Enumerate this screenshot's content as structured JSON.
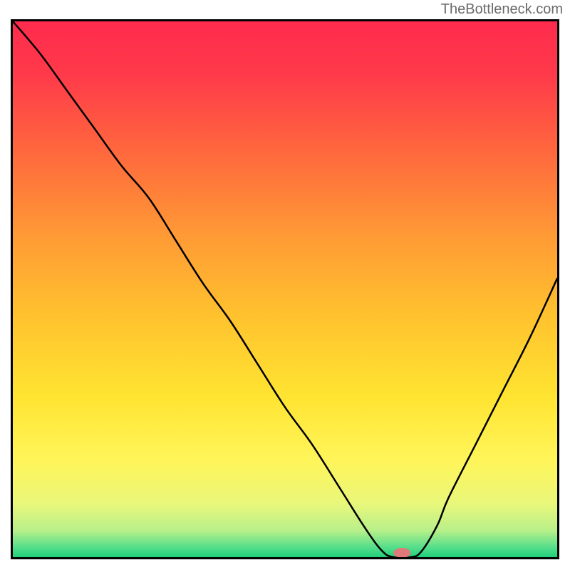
{
  "watermark": "TheBottleneck.com",
  "chart_data": {
    "type": "line",
    "title": "",
    "xlabel": "",
    "ylabel": "",
    "xlim": [
      0,
      100
    ],
    "ylim": [
      0,
      100
    ],
    "x": [
      0,
      5,
      10,
      15,
      20,
      25,
      30,
      35,
      40,
      45,
      50,
      55,
      60,
      65,
      68,
      70,
      73,
      75,
      78,
      80,
      85,
      90,
      95,
      100
    ],
    "y": [
      100,
      94,
      87,
      80,
      73,
      67,
      59,
      51,
      44,
      36,
      28,
      21,
      13,
      5,
      1,
      0,
      0,
      1,
      6,
      11,
      21,
      31,
      41,
      52
    ],
    "marker": {
      "x": 71.5,
      "y": 0.8,
      "color": "#e07a7a"
    },
    "background_gradient": {
      "stops": [
        {
          "offset": 0.0,
          "color": "#ff2b4d"
        },
        {
          "offset": 0.1,
          "color": "#ff3a4a"
        },
        {
          "offset": 0.25,
          "color": "#ff6a3d"
        },
        {
          "offset": 0.4,
          "color": "#ff9a35"
        },
        {
          "offset": 0.55,
          "color": "#ffc22e"
        },
        {
          "offset": 0.7,
          "color": "#ffe431"
        },
        {
          "offset": 0.82,
          "color": "#fff55a"
        },
        {
          "offset": 0.9,
          "color": "#e9f77a"
        },
        {
          "offset": 0.95,
          "color": "#b8f08a"
        },
        {
          "offset": 0.985,
          "color": "#4bdc8a"
        },
        {
          "offset": 1.0,
          "color": "#1fcf7a"
        }
      ]
    }
  }
}
